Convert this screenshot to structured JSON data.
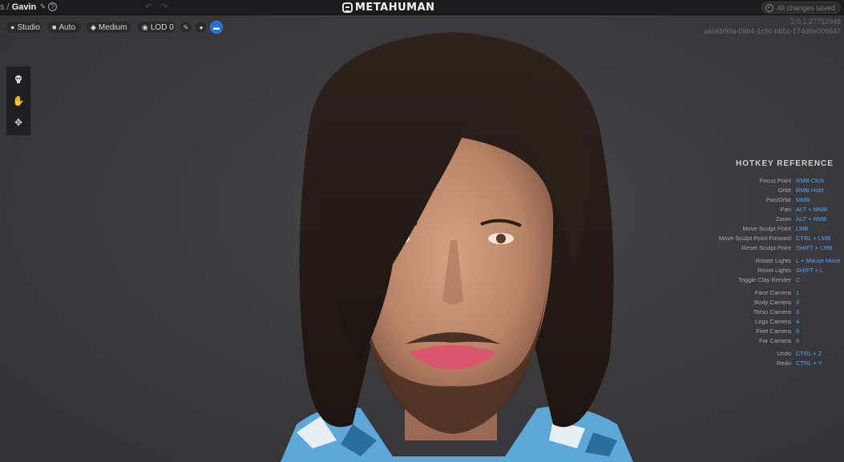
{
  "topbar": {
    "breadcrumb_prefix": "s /",
    "character_name": "Gavin",
    "edit_icon": "pencil-icon",
    "help_icon": "question-icon",
    "undo_icon": "undo-icon",
    "redo_icon": "redo-icon",
    "logo_text": "METAHUMAN",
    "saved_status": "All changes saved"
  },
  "viewport_toolbar": {
    "lighting": "Studio",
    "camera": "Auto",
    "quality": "Medium",
    "lod": "LOD 0",
    "icons": [
      "lighting-icon",
      "camera-icon",
      "quality-icon",
      "lod-icon",
      "brush-icon",
      "sphere-icon",
      "render-icon"
    ]
  },
  "version": {
    "build": "2.0.1.27752948",
    "hash": "a6b6b99a-09b4-1c9c-b65c-174dde009647"
  },
  "left_tools": [
    "select-icon",
    "hand-icon",
    "move-icon"
  ],
  "hotkeys": {
    "title": "HOTKEY REFERENCE",
    "items": [
      {
        "action": "Focus Point",
        "key": "RMB Click"
      },
      {
        "action": "Orbit",
        "key": "RMB Hold"
      },
      {
        "action": "Pan/Orbit",
        "key": "MMB"
      },
      {
        "action": "Pan",
        "key": "ALT + MMB"
      },
      {
        "action": "Zoom",
        "key": "ALT + RMB"
      },
      {
        "action": "Move Sculpt Point",
        "key": "LMB"
      },
      {
        "action": "Move Sculpt Point Forward",
        "key": "CTRL + LMB"
      },
      {
        "action": "Reset Sculpt Point",
        "key": "SHIFT + LMB"
      },
      {
        "action": "Rotate Lights",
        "key": "L + Mouse Move"
      },
      {
        "action": "Reset Lights",
        "key": "SHIFT + L"
      },
      {
        "action": "Toggle Clay Render",
        "key": "C"
      },
      {
        "action": "Face Camera",
        "key": "1"
      },
      {
        "action": "Body Camera",
        "key": "2"
      },
      {
        "action": "Torso Camera",
        "key": "3"
      },
      {
        "action": "Legs Camera",
        "key": "4"
      },
      {
        "action": "Feet Camera",
        "key": "5"
      },
      {
        "action": "Far Camera",
        "key": "6"
      },
      {
        "action": "Undo",
        "key": "CTRL + Z"
      },
      {
        "action": "Redo",
        "key": "CTRL + Y"
      }
    ]
  },
  "colors": {
    "accent": "#1f6fd6",
    "hotkey_key": "#4ea3ff",
    "topbar": "#1c1c1e",
    "viewport_bg": "#3b3b3d"
  }
}
